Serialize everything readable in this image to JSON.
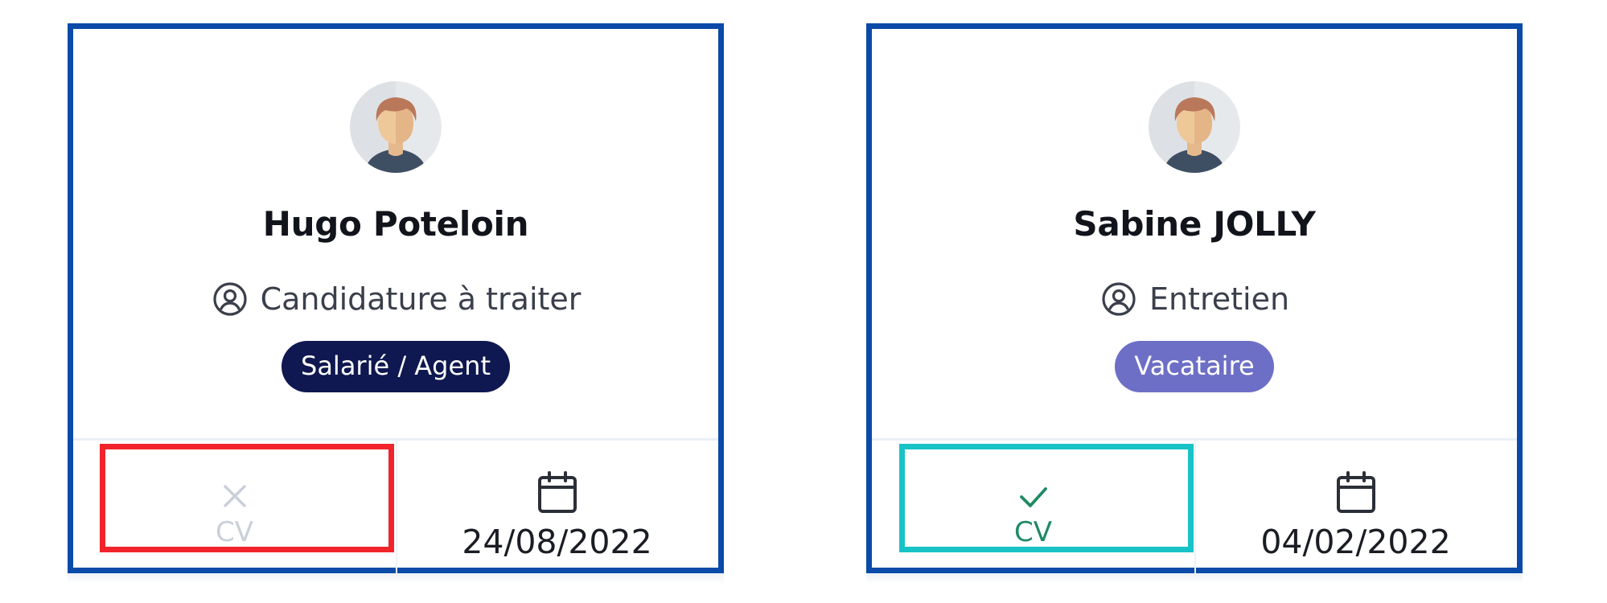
{
  "candidates": [
    {
      "name": "Hugo Poteloin",
      "status": "Candidature à traiter",
      "status_icon": "user-circle-icon",
      "badge": {
        "label": "Salarié / Agent",
        "color": "#0f1850"
      },
      "cv": {
        "label": "CV",
        "present": false,
        "icon": "x-icon",
        "color": "#c9d0da"
      },
      "date": "24/08/2022",
      "date_icon": "calendar-icon",
      "highlight_color": "#f2242b"
    },
    {
      "name": "Sabine JOLLY",
      "status": "Entretien",
      "status_icon": "user-circle-icon",
      "badge": {
        "label": "Vacataire",
        "color": "#6d6fc6"
      },
      "cv": {
        "label": "CV",
        "present": true,
        "icon": "check-icon",
        "color": "#1f8a63"
      },
      "date": "04/02/2022",
      "date_icon": "calendar-icon",
      "highlight_color": "#17c3c7"
    }
  ],
  "colors": {
    "card_border": "#0a4aa8",
    "text_dark": "#12141c",
    "text_muted": "#3a3f4b"
  }
}
